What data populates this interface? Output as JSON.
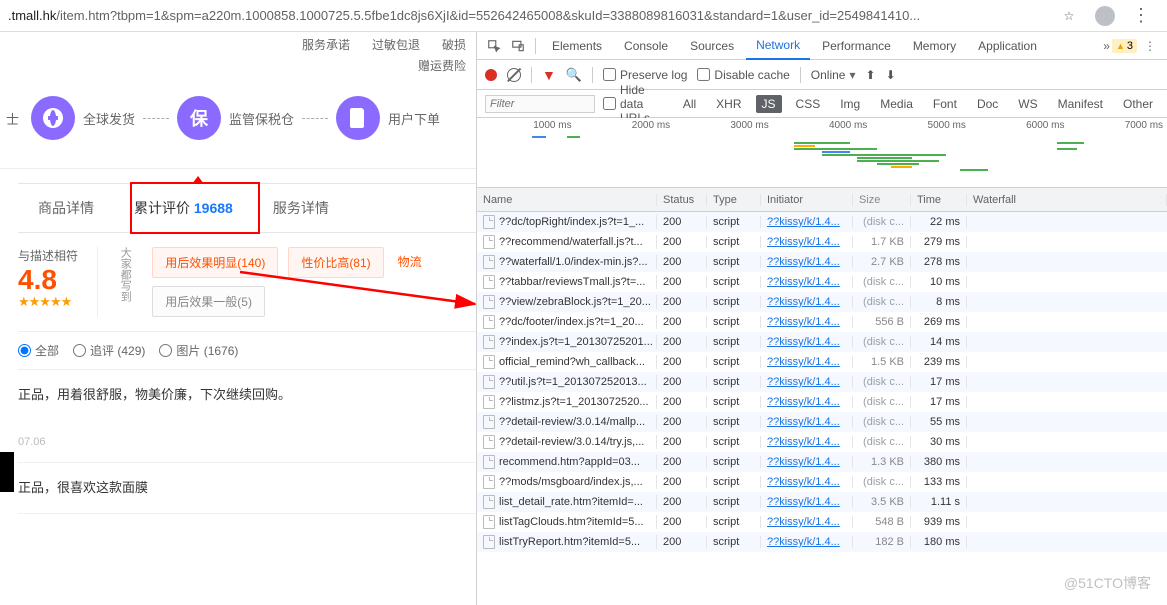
{
  "url": {
    "domain": ".tmall.hk",
    "rest": "/item.htm?tbpm=1&spm=a220m.1000858.1000725.5.5fbe1dc8js6XjI&id=552642465008&skuId=3388089816031&standard=1&user_id=2549841410..."
  },
  "promise": {
    "service": "服务承诺",
    "allergy": "过敏包退",
    "broken": "破损",
    "shipping": "赠运费险"
  },
  "flow": {
    "ship": "全球发货",
    "customs": "监管保税仓",
    "user": "用户下单",
    "pre": "士",
    "circle2": "保"
  },
  "tabs": {
    "detail": "商品详情",
    "reviews": "累计评价",
    "count": "19688",
    "service": "服务详情"
  },
  "review": {
    "label": "与描述相符",
    "score": "4.8",
    "stars": "★★★★★",
    "note": "大家都写到",
    "tag1": "用后效果明显(140)",
    "tag2": "性价比高(81)",
    "tag3": "物流",
    "tag4": "用后效果一般(5)"
  },
  "filters": {
    "all": "全部",
    "append": "追评 (429)",
    "image": "图片 (1676)"
  },
  "comments": {
    "c1_text": "正品，用着很舒服，物美价廉，下次继续回购。",
    "c1_date": "07.06",
    "c2_text": "正品，很喜欢这款面膜"
  },
  "devtools": {
    "tabs": {
      "elements": "Elements",
      "console": "Console",
      "sources": "Sources",
      "network": "Network",
      "performance": "Performance",
      "memory": "Memory",
      "application": "Application"
    },
    "warn": "3",
    "toolbar": {
      "preserve": "Preserve log",
      "disable": "Disable cache",
      "online": "Online"
    },
    "filter": {
      "placeholder": "Filter",
      "hide": "Hide data URLs",
      "all": "All",
      "xhr": "XHR",
      "js": "JS",
      "css": "CSS",
      "img": "Img",
      "media": "Media",
      "font": "Font",
      "doc": "Doc",
      "ws": "WS",
      "manifest": "Manifest",
      "other": "Other"
    },
    "timeline": [
      "1000 ms",
      "2000 ms",
      "3000 ms",
      "4000 ms",
      "5000 ms",
      "6000 ms",
      "7000 ms"
    ],
    "headers": {
      "name": "Name",
      "status": "Status",
      "type": "Type",
      "initiator": "Initiator",
      "size": "Size",
      "time": "Time",
      "waterfall": "Waterfall"
    },
    "rows": [
      {
        "name": "??dc/topRight/index.js?t=1_...",
        "status": "200",
        "type": "script",
        "init": "??kissy/k/1.4...",
        "size": "(disk c...",
        "time": "22 ms",
        "wf": {
          "l": 1,
          "w": 1,
          "c": "g2"
        }
      },
      {
        "name": "??recommend/waterfall.js?t...",
        "status": "200",
        "type": "script",
        "init": "??kissy/k/1.4...",
        "size": "1.7 KB",
        "time": "279 ms",
        "wf": {
          "l": 50,
          "w": 6,
          "c": "g2"
        }
      },
      {
        "name": "??waterfall/1.0/index-min.js?...",
        "status": "200",
        "type": "script",
        "init": "??kissy/k/1.4...",
        "size": "2.7 KB",
        "time": "278 ms",
        "wf": {
          "l": 50,
          "w": 6,
          "c": "g2"
        }
      },
      {
        "name": "??tabbar/reviewsTmall.js?t=...",
        "status": "200",
        "type": "script",
        "init": "??kissy/k/1.4...",
        "size": "(disk c...",
        "time": "10 ms",
        "wf": {
          "l": 50,
          "w": 1,
          "c": "g2"
        }
      },
      {
        "name": "??view/zebraBlock.js?t=1_20...",
        "status": "200",
        "type": "script",
        "init": "??kissy/k/1.4...",
        "size": "(disk c...",
        "time": "8 ms",
        "wf": {
          "l": 50,
          "w": 1,
          "c": "g2"
        }
      },
      {
        "name": "??dc/footer/index.js?t=1_20...",
        "status": "200",
        "type": "script",
        "init": "??kissy/k/1.4...",
        "size": "556 B",
        "time": "269 ms",
        "wf": {
          "l": 50,
          "w": 6,
          "c": "g2"
        }
      },
      {
        "name": "??index.js?t=1_20130725201...",
        "status": "200",
        "type": "script",
        "init": "??kissy/k/1.4...",
        "size": "(disk c...",
        "time": "14 ms",
        "wf": {
          "l": 52,
          "w": 1,
          "c": "g2"
        }
      },
      {
        "name": "official_remind?wh_callback...",
        "status": "200",
        "type": "script",
        "init": "??kissy/k/1.4...",
        "size": "1.5 KB",
        "time": "239 ms",
        "wf": {
          "l": 53,
          "w": 6,
          "c": "g2"
        }
      },
      {
        "name": "??util.js?t=1_201307252013...",
        "status": "200",
        "type": "script",
        "init": "??kissy/k/1.4...",
        "size": "(disk c...",
        "time": "17 ms",
        "wf": {
          "l": 54,
          "w": 1,
          "c": "g2"
        }
      },
      {
        "name": "??listmz.js?t=1_2013072520...",
        "status": "200",
        "type": "script",
        "init": "??kissy/k/1.4...",
        "size": "(disk c...",
        "time": "17 ms",
        "wf": {
          "l": 54,
          "w": 1,
          "c": "g2"
        }
      },
      {
        "name": "??detail-review/3.0.14/mallp...",
        "status": "200",
        "type": "script",
        "init": "??kissy/k/1.4...",
        "size": "(disk c...",
        "time": "55 ms",
        "wf": {
          "l": 55,
          "w": 2,
          "c": "g2"
        }
      },
      {
        "name": "??detail-review/3.0.14/try.js,...",
        "status": "200",
        "type": "script",
        "init": "??kissy/k/1.4...",
        "size": "(disk c...",
        "time": "30 ms",
        "wf": {
          "l": 55,
          "w": 1,
          "c": "g2"
        }
      },
      {
        "name": "recommend.htm?appId=03...",
        "status": "200",
        "type": "script",
        "init": "??kissy/k/1.4...",
        "size": "1.3 KB",
        "time": "380 ms",
        "wf": {
          "l": 55,
          "w": 10,
          "c": "g2",
          "pink": true
        }
      },
      {
        "name": "??mods/msgboard/index.js,...",
        "status": "200",
        "type": "script",
        "init": "??kissy/k/1.4...",
        "size": "(disk c...",
        "time": "133 ms",
        "wf": {
          "l": 57,
          "w": 3,
          "c": "g2"
        }
      },
      {
        "name": "list_detail_rate.htm?itemId=...",
        "status": "200",
        "type": "script",
        "init": "??kissy/k/1.4...",
        "size": "3.5 KB",
        "time": "1.11 s",
        "wf": {
          "l": 57,
          "w": 28,
          "c": "g2",
          "pink": true
        }
      },
      {
        "name": "listTagClouds.htm?itemId=5...",
        "status": "200",
        "type": "script",
        "init": "??kissy/k/1.4...",
        "size": "548 B",
        "time": "939 ms",
        "wf": {
          "l": 62,
          "w": 24,
          "c": "wait"
        }
      },
      {
        "name": "listTryReport.htm?itemId=5...",
        "status": "200",
        "type": "script",
        "init": "??kissy/k/1.4...",
        "size": "182 B",
        "time": "180 ms",
        "wf": {
          "l": 62,
          "w": 5,
          "c": "g2"
        }
      }
    ]
  },
  "watermark": "@51CTO博客"
}
